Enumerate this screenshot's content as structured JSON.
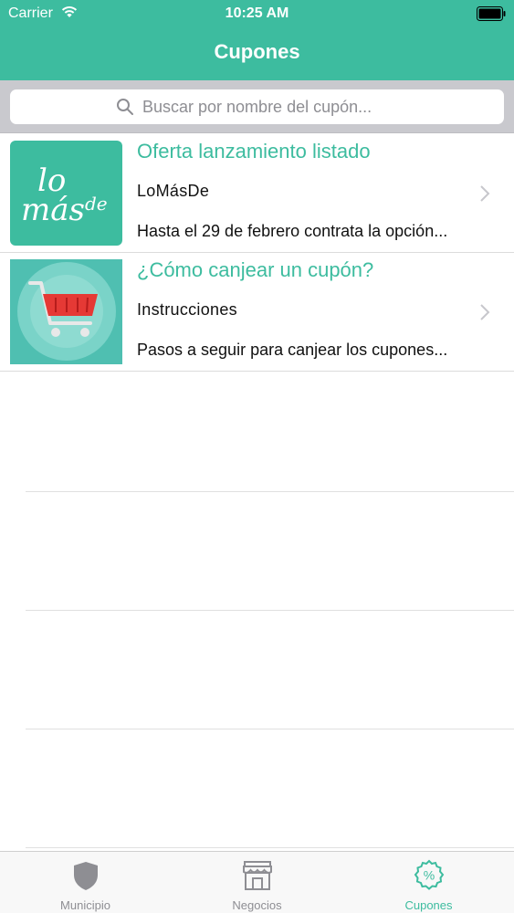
{
  "status_bar": {
    "carrier": "Carrier",
    "time": "10:25 AM"
  },
  "nav": {
    "title": "Cupones"
  },
  "search": {
    "placeholder": "Buscar por nombre del cupón..."
  },
  "coupons": [
    {
      "title": "Oferta lanzamiento listado",
      "subtitle": "LoMásDe",
      "description": "Hasta el 29 de febrero contrata la opción...",
      "thumb_lines": [
        "lo",
        "más",
        "de"
      ],
      "thumb_color": "#3dbc9f"
    },
    {
      "title": "¿Cómo canjear un cupón?",
      "subtitle": "Instrucciones",
      "description": "Pasos a seguir para canjear los cupones...",
      "thumb_icon": "shopping-cart-icon",
      "thumb_color": "#4fbfb1"
    }
  ],
  "tabs": [
    {
      "label": "Municipio",
      "icon": "shield-icon",
      "active": false
    },
    {
      "label": "Negocios",
      "icon": "store-icon",
      "active": false
    },
    {
      "label": "Cupones",
      "icon": "percent-badge-icon",
      "active": true
    }
  ],
  "colors": {
    "accent": "#3dbc9f",
    "inactive": "#8e8e93"
  }
}
